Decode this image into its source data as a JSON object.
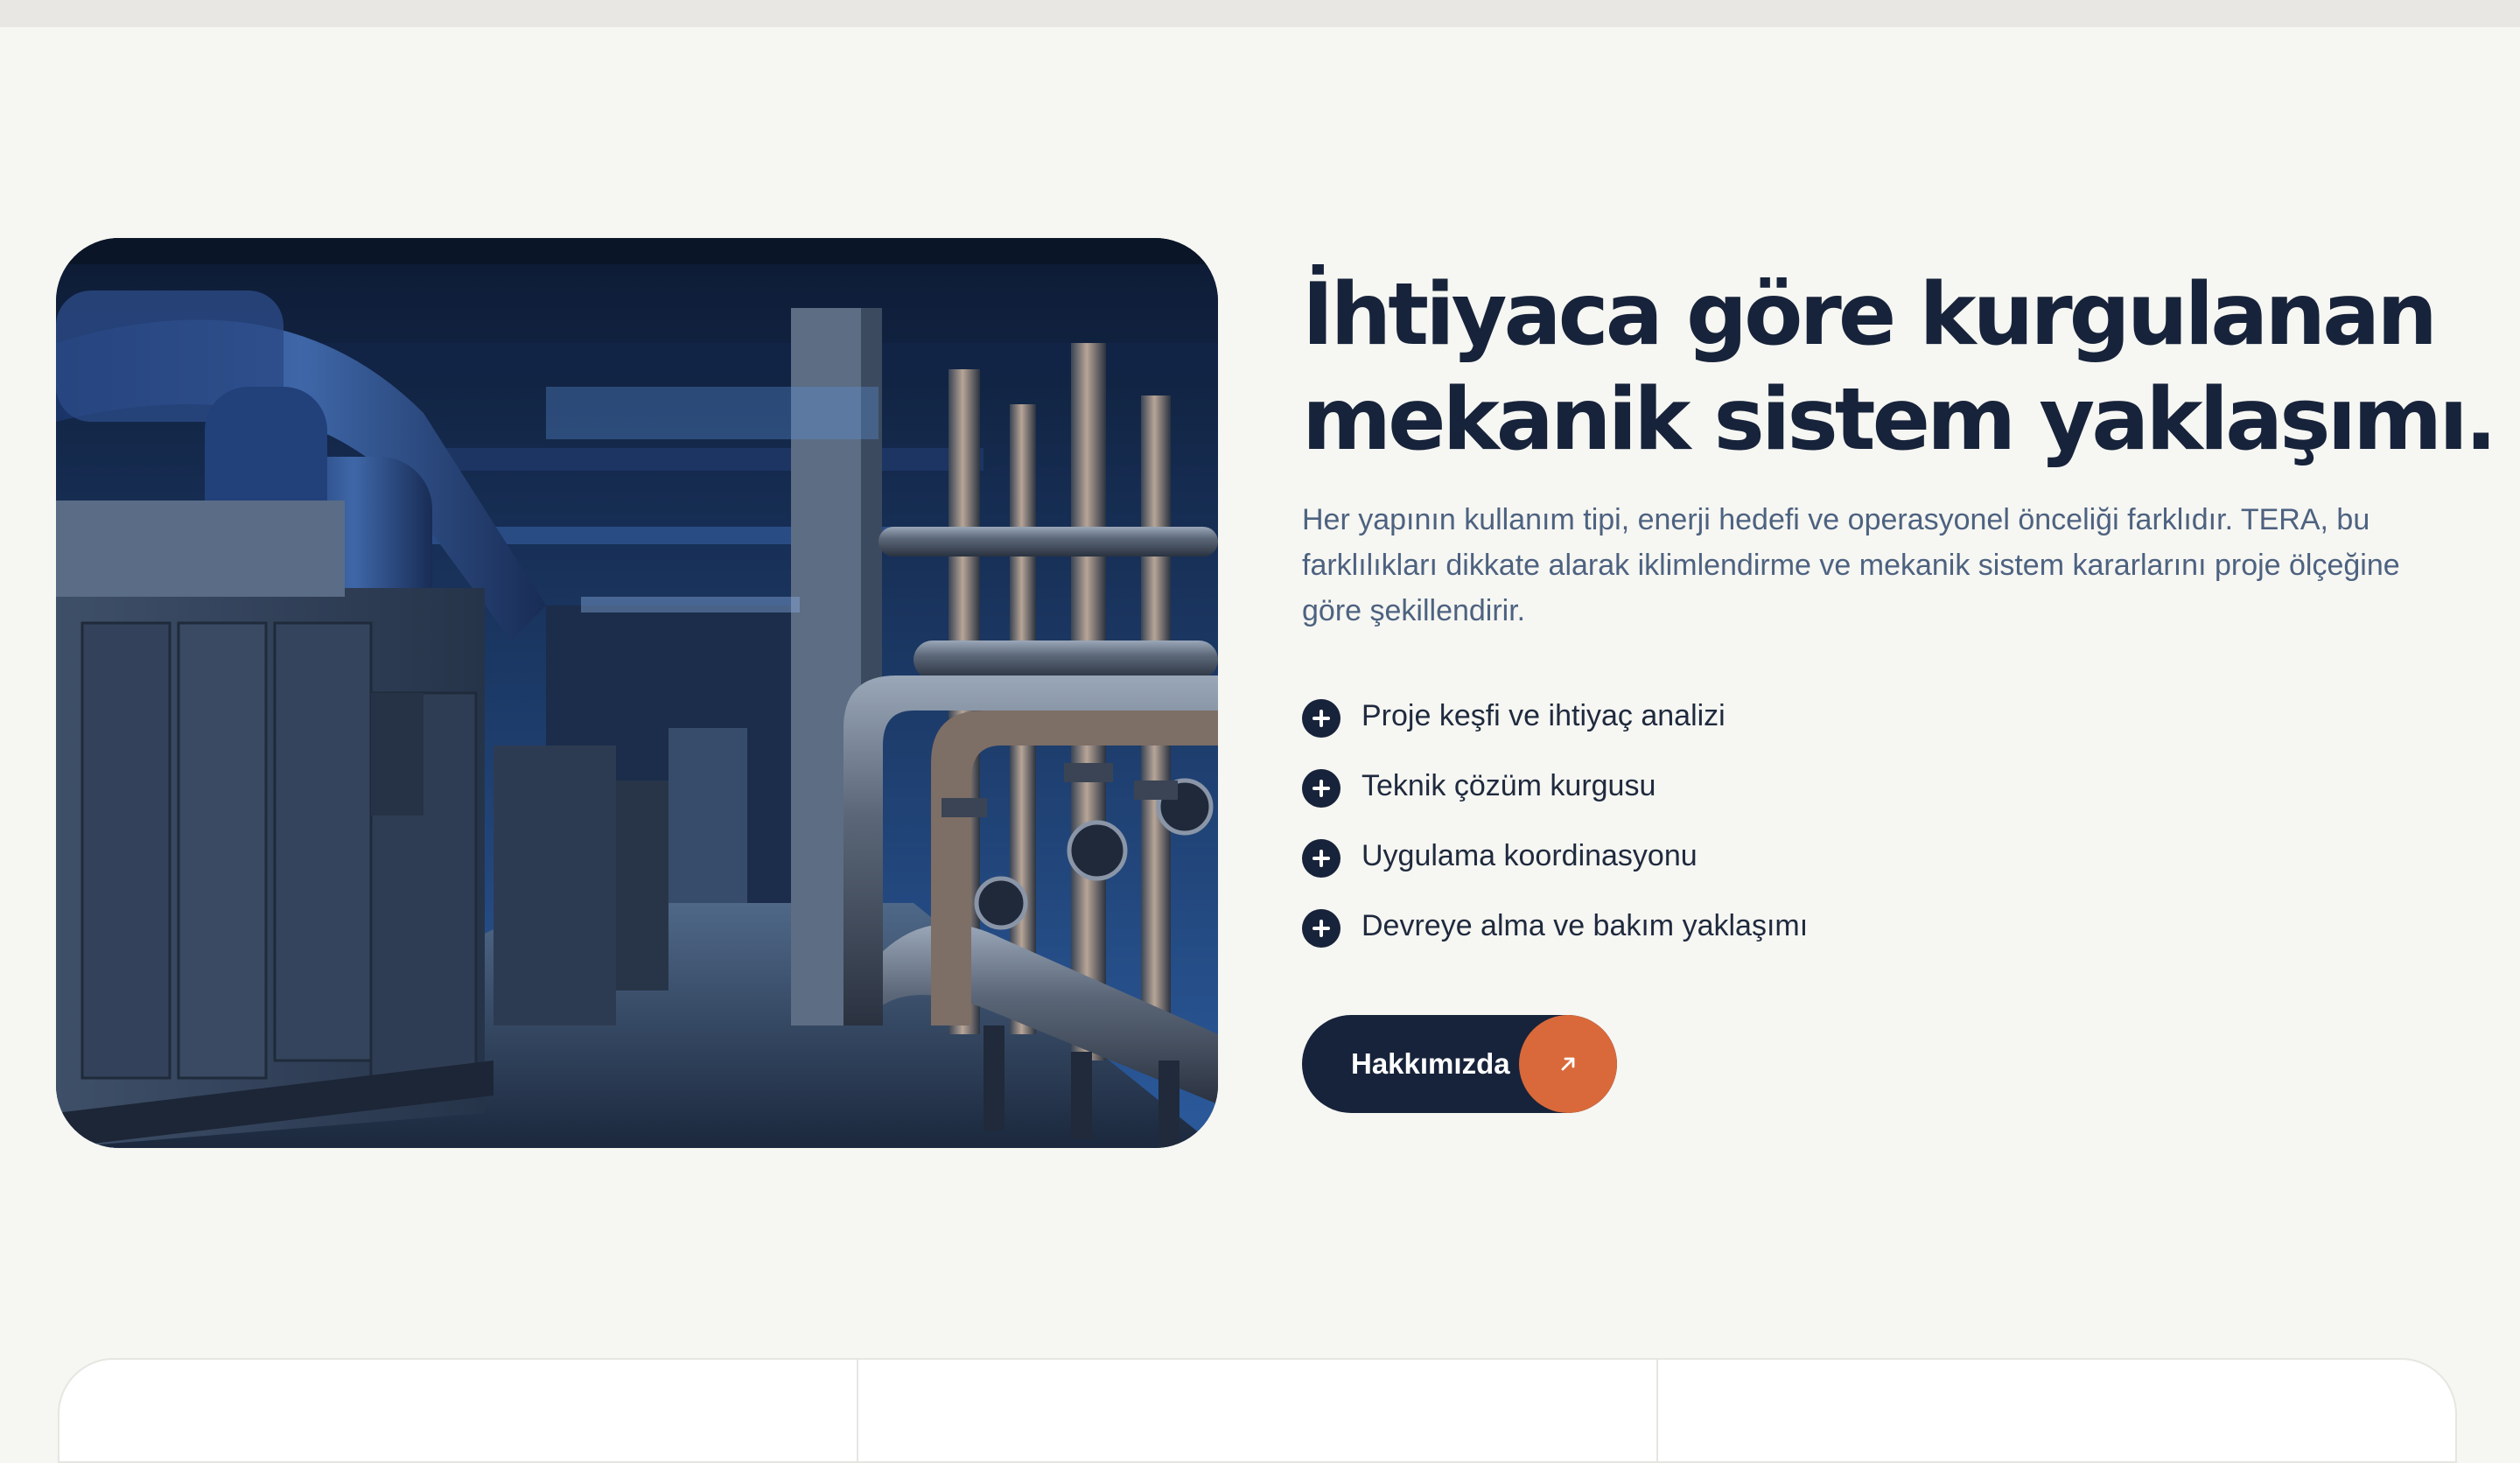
{
  "hero": {
    "heading_line1": "İhtiyaca göre kurgulanan",
    "heading_line2": "mekanik sistem yaklaşımı.",
    "description": "Her yapının kullanım tipi, enerji hedefi ve operasyonel önceliği farklıdır. TERA, bu farklılıkları dikkate alarak iklimlendirme ve mekanik sistem kararlarını proje ölçeğine göre şekillendirir.",
    "features": [
      {
        "label": "Proje keşfi ve ihtiyaç analizi",
        "icon": "plus-icon"
      },
      {
        "label": "Teknik çözüm kurgusu",
        "icon": "plus-icon"
      },
      {
        "label": "Uygulama koordinasyonu",
        "icon": "plus-icon"
      },
      {
        "label": "Devreye alma ve bakım yaklaşımı",
        "icon": "plus-icon"
      }
    ],
    "cta": {
      "label": "Hakkımızda",
      "icon": "arrow-up-right-icon"
    },
    "image": {
      "subject": "mechanical room with ducts and pipes",
      "icon": "photo"
    }
  },
  "colors": {
    "background": "#f6f6f2",
    "navy": "#17233a",
    "accent_orange": "#d9693a",
    "muted_text": "#4d6280"
  }
}
